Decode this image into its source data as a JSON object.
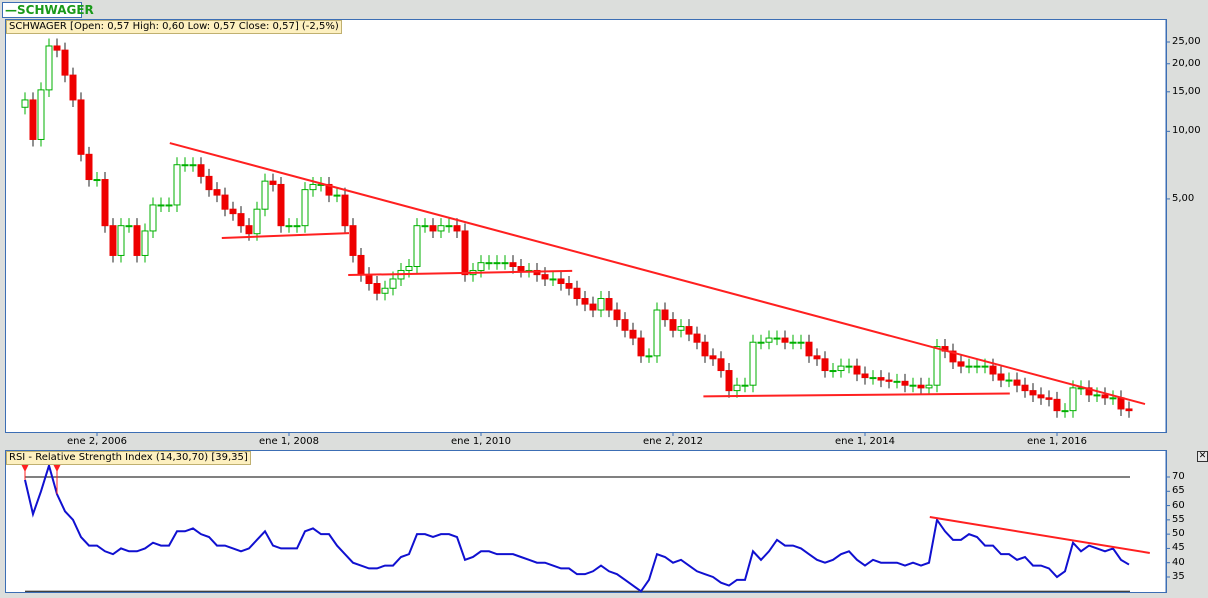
{
  "legend": {
    "label": "SCHWAGER",
    "color": "#1a9a1a"
  },
  "price_info": "SCHWAGER [Open: 0,57  High: 0,60  Low: 0,57  Close: 0,57] (-2,5%)",
  "rsi_info": "RSI - Relative Strength Index (14,30,70) [39,35]",
  "close_icon": "close-icon",
  "colors": {
    "up": "#00b000",
    "down": "#ee0000",
    "rsi": "#1010d0",
    "trend": "#ff2020",
    "axis": "#3c6eb4"
  },
  "chart_data": [
    {
      "type": "candlestick",
      "title": "SCHWAGER",
      "scale": "log",
      "yticks": [
        "25,00",
        "20,00",
        "15,00",
        "10,00",
        "5,00"
      ],
      "ytick_values": [
        25,
        20,
        15,
        10,
        5
      ],
      "xticks": [
        {
          "label": "ene 2, 2006",
          "index": 9
        },
        {
          "label": "ene 1, 2008",
          "index": 33
        },
        {
          "label": "ene 1, 2010",
          "index": 57
        },
        {
          "label": "ene 2, 2012",
          "index": 81
        },
        {
          "label": "ene 1, 2014",
          "index": 105
        },
        {
          "label": "ene 1, 2016",
          "index": 129
        }
      ],
      "period": "monthly",
      "first_open": 12.8,
      "close": [
        13.8,
        9.2,
        15.3,
        24,
        23,
        17.8,
        13.8,
        7.9,
        6.1,
        6.1,
        3.8,
        2.8,
        3.8,
        3.8,
        2.8,
        3.6,
        4.7,
        4.7,
        4.7,
        7.1,
        7.1,
        7.1,
        6.3,
        5.5,
        5.2,
        4.5,
        4.3,
        3.8,
        3.5,
        4.5,
        6.0,
        5.8,
        3.8,
        3.8,
        3.8,
        5.5,
        5.8,
        5.8,
        5.2,
        5.2,
        3.8,
        2.8,
        2.3,
        2.1,
        1.9,
        2.0,
        2.2,
        2.4,
        2.5,
        3.8,
        3.8,
        3.6,
        3.8,
        3.8,
        3.6,
        2.3,
        2.4,
        2.6,
        2.6,
        2.6,
        2.6,
        2.5,
        2.4,
        2.4,
        2.3,
        2.2,
        2.2,
        2.1,
        2.0,
        1.8,
        1.7,
        1.6,
        1.8,
        1.6,
        1.45,
        1.3,
        1.2,
        1.0,
        1.0,
        1.6,
        1.45,
        1.3,
        1.35,
        1.25,
        1.15,
        1.0,
        0.97,
        0.86,
        0.7,
        0.74,
        0.74,
        1.15,
        1.15,
        1.2,
        1.2,
        1.15,
        1.15,
        1.15,
        1.0,
        0.97,
        0.86,
        0.86,
        0.9,
        0.9,
        0.83,
        0.8,
        0.8,
        0.78,
        0.77,
        0.77,
        0.74,
        0.74,
        0.72,
        0.74,
        1.1,
        1.05,
        0.94,
        0.9,
        0.9,
        0.9,
        0.9,
        0.83,
        0.78,
        0.78,
        0.74,
        0.7,
        0.67,
        0.65,
        0.64,
        0.57,
        0.57,
        0.72,
        0.72,
        0.67,
        0.67,
        0.65,
        0.65,
        0.58,
        0.57
      ],
      "trendlines": [
        [
          [
            18.1,
            8.87
          ],
          [
            140,
            0.61
          ]
        ],
        [
          [
            24.6,
            3.35
          ],
          [
            40.5,
            3.52
          ]
        ],
        [
          [
            40.4,
            2.29
          ],
          [
            68.4,
            2.39
          ]
        ],
        [
          [
            84.8,
            0.66
          ],
          [
            123.1,
            0.68
          ]
        ]
      ]
    },
    {
      "type": "line",
      "title": "RSI - Relative Strength Index (14,30,70)",
      "ylim": [
        30,
        72
      ],
      "yticks": [
        "70",
        "65",
        "60",
        "55",
        "50",
        "45",
        "40",
        "35"
      ],
      "ytick_values": [
        70,
        65,
        60,
        55,
        50,
        45,
        40,
        35
      ],
      "levels": [
        70,
        30
      ],
      "overbought_markers": [
        0,
        4
      ],
      "values": [
        69,
        57,
        65,
        74,
        64,
        58,
        55,
        49,
        46,
        46,
        44,
        43,
        45,
        44,
        44,
        45,
        47,
        46,
        46,
        51,
        51,
        52,
        50,
        49,
        46,
        46,
        45,
        44,
        45,
        48,
        51,
        46,
        45,
        45,
        45,
        51,
        52,
        50,
        50,
        46,
        43,
        40,
        39,
        38,
        38,
        39,
        39,
        42,
        43,
        50,
        50,
        49,
        50,
        50,
        49,
        41,
        42,
        44,
        44,
        43,
        43,
        43,
        42,
        41,
        40,
        40,
        39,
        38,
        38,
        36,
        36,
        37,
        39,
        37,
        36,
        34,
        32,
        30,
        34,
        43,
        42,
        40,
        41,
        39,
        37,
        36,
        35,
        33,
        32,
        34,
        34,
        44,
        41,
        44,
        48,
        46,
        46,
        45,
        43,
        41,
        40,
        41,
        43,
        44,
        41,
        39,
        41,
        40,
        40,
        40,
        39,
        40,
        39,
        40,
        55,
        51,
        48,
        48,
        50,
        49,
        46,
        46,
        43,
        43,
        41,
        42,
        39,
        39,
        38,
        35,
        37,
        47,
        44,
        46,
        45,
        44,
        45,
        41,
        39.35
      ],
      "trendlines": [
        [
          [
            113.1,
            56
          ],
          [
            140.6,
            43.4
          ]
        ]
      ]
    }
  ]
}
